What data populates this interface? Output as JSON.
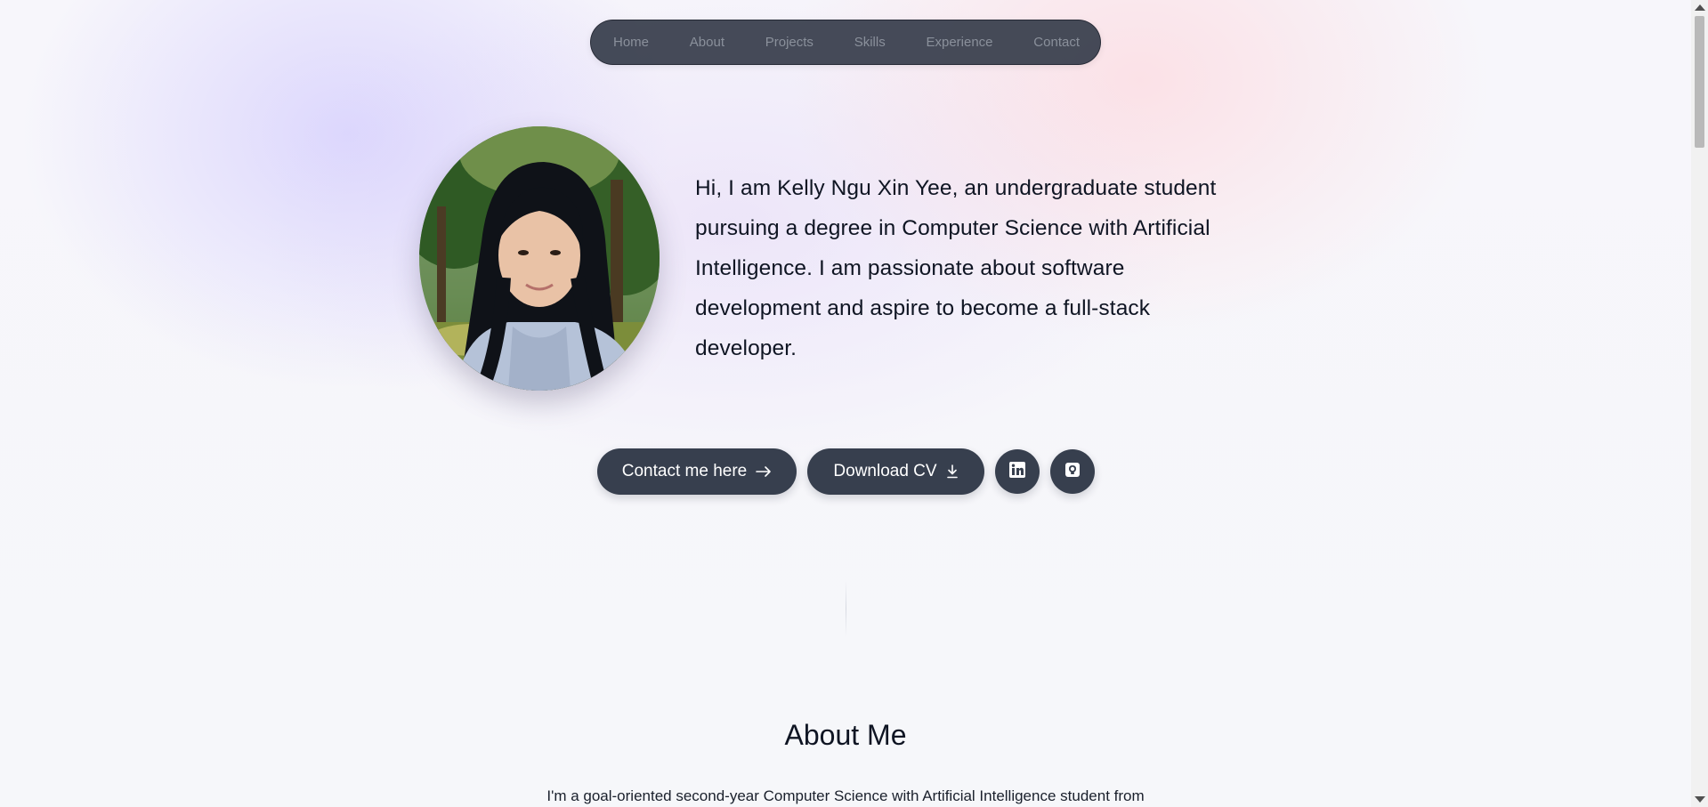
{
  "nav": {
    "items": [
      {
        "label": "Home"
      },
      {
        "label": "About"
      },
      {
        "label": "Projects"
      },
      {
        "label": "Skills"
      },
      {
        "label": "Experience"
      },
      {
        "label": "Contact"
      }
    ]
  },
  "hero": {
    "intro_lines": [
      "Hi, I am Kelly Ngu Xin Yee, an undergraduate student",
      "pursuing a degree in Computer Science with Artificial",
      "Intelligence. I am passionate about software",
      "development and aspire to become a full-stack",
      "developer."
    ],
    "contact_button": "Contact me here",
    "cv_button": "Download CV"
  },
  "icons": {
    "contact": "arrow-right-icon",
    "cv": "download-icon",
    "linkedin": "linkedin-icon",
    "github": "github-icon"
  },
  "about": {
    "title": "About Me",
    "text": "I'm a goal-oriented second-year Computer Science with Artificial Intelligence student from"
  },
  "colors": {
    "nav_bg": "#373d4b",
    "nav_text": "#8a909b",
    "button_bg": "#373f4e",
    "button_text": "#ffffff",
    "text": "#0f1523"
  }
}
